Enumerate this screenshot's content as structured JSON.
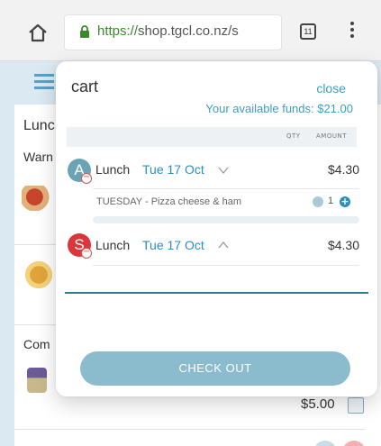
{
  "browser": {
    "url_scheme": "https://",
    "url_rest": "shop.tgcl.co.nz/s",
    "tab_count": "11"
  },
  "background": {
    "heading": "Lunc",
    "section1": "Warn",
    "section2": "Com",
    "price": "$5.00"
  },
  "cart": {
    "title": "cart",
    "close_label": "close",
    "funds": "Your available funds: $21.00",
    "col_qty": "QTY",
    "col_amount": "AMOUNT",
    "items": [
      {
        "avatar": "A",
        "name": "Lunch",
        "date": "Tue 17 Oct",
        "price": "$4.30",
        "expanded": true,
        "sub_item": "TUESDAY - Pizza cheese & ham",
        "qty": "1"
      },
      {
        "avatar": "S",
        "name": "Lunch",
        "date": "Tue 17 Oct",
        "price": "$4.30",
        "expanded": false
      }
    ],
    "checkout_label": "CHECK OUT"
  },
  "colors": {
    "accent": "#3d9ec4",
    "avatar_a": "#6aa4b4",
    "avatar_s": "#d9373b",
    "checkout": "#8bbccd"
  }
}
